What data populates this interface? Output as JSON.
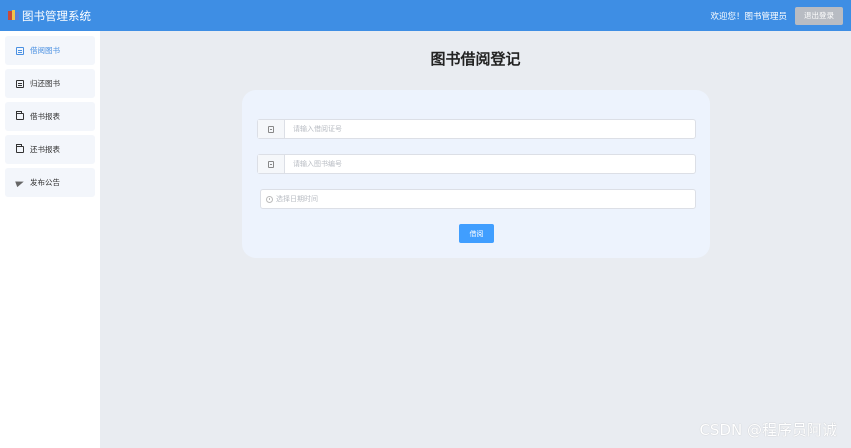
{
  "app": {
    "title": "图书管理系统",
    "logo_icon": "books-icon"
  },
  "header": {
    "welcome": "欢迎您！图书管理员",
    "logout_label": "退出登录"
  },
  "sidebar": {
    "items": [
      {
        "label": "借阅图书",
        "icon": "document-icon",
        "active": true
      },
      {
        "label": "归还图书",
        "icon": "document-icon",
        "active": false
      },
      {
        "label": "借书报表",
        "icon": "folder-icon",
        "active": false
      },
      {
        "label": "还书报表",
        "icon": "folder-icon",
        "active": false
      },
      {
        "label": "发布公告",
        "icon": "send-icon",
        "active": false
      }
    ]
  },
  "main": {
    "title": "图书借阅登记",
    "form": {
      "card_number": {
        "value": "",
        "placeholder": "请输入借阅证号",
        "icon": "card-icon"
      },
      "book_code": {
        "value": "",
        "placeholder": "请输入图书编号",
        "icon": "card-icon"
      },
      "date": {
        "value": "",
        "placeholder": "选择日期时间",
        "icon": "clock-icon"
      },
      "submit_label": "借阅"
    }
  },
  "watermark": "CSDN @程序员阿诚",
  "colors": {
    "header_bg": "#3e8ee4",
    "accent": "#409eff",
    "page_bg": "#e9ecf1",
    "card_bg": "#edf3fd"
  }
}
